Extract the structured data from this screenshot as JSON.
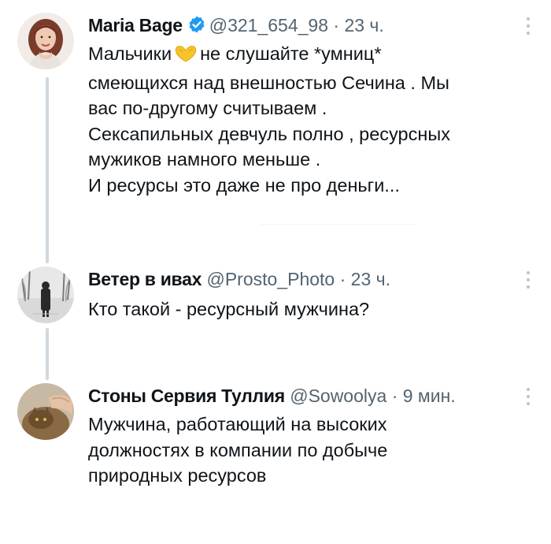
{
  "tweets": [
    {
      "display_name": "Maria Bage",
      "handle": "@321_654_98",
      "separator": "·",
      "time": "23 ч.",
      "verified": true,
      "lines": [
        {
          "before": "Мальчики",
          "emoji": "yellow-heart-hands-emoji",
          "after": "не слушайте *умниц*"
        },
        "смеющихся над внешностью Сечина .  Мы",
        "вас по-другому считываем .",
        "Сексапильных девчуль полно , ресурсных",
        "мужиков намного меньше .",
        "И ресурсы это даже не про деньги..."
      ]
    },
    {
      "display_name": "Ветер в ивах",
      "handle": "@Prosto_Photo",
      "separator": "·",
      "time": "23 ч.",
      "verified": false,
      "lines": [
        "Кто такой - ресурсный мужчина?"
      ]
    },
    {
      "display_name": "Стоны Сервия Туллия",
      "handle": "@Sowoolya",
      "separator": "·",
      "time": "9 мин.",
      "verified": false,
      "lines": [
        "Мужчина, работающий на высоких",
        "должностях в компании по добыче",
        "природных ресурсов"
      ]
    }
  ],
  "icons": {
    "verified": "verified-badge-icon",
    "more": "more-options-icon"
  },
  "colors": {
    "verified_blue": "#1d9bf0",
    "text": "#0f1419",
    "secondary": "#536471",
    "thread_line": "#cfd9de"
  }
}
